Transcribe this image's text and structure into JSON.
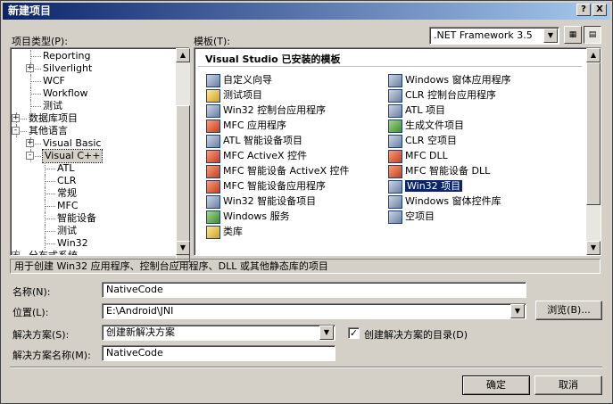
{
  "window": {
    "title": "新建项目",
    "help_btn": "?",
    "close_btn": "X"
  },
  "project_types": {
    "label": "项目类型(P):",
    "items": [
      {
        "text": "Reporting",
        "level": 2,
        "expander": ""
      },
      {
        "text": "Silverlight",
        "level": 2,
        "expander": "+"
      },
      {
        "text": "WCF",
        "level": 2,
        "expander": ""
      },
      {
        "text": "Workflow",
        "level": 2,
        "expander": ""
      },
      {
        "text": "测试",
        "level": 2,
        "expander": ""
      },
      {
        "text": "数据库项目",
        "level": 1,
        "expander": "+"
      },
      {
        "text": "其他语言",
        "level": 1,
        "expander": "-"
      },
      {
        "text": "Visual Basic",
        "level": 2,
        "expander": "+"
      },
      {
        "text": "Visual C++",
        "level": 2,
        "expander": "-"
      },
      {
        "text": "ATL",
        "level": 3,
        "expander": ""
      },
      {
        "text": "CLR",
        "level": 3,
        "expander": ""
      },
      {
        "text": "常规",
        "level": 3,
        "expander": ""
      },
      {
        "text": "MFC",
        "level": 3,
        "expander": ""
      },
      {
        "text": "智能设备",
        "level": 3,
        "expander": ""
      },
      {
        "text": "测试",
        "level": 3,
        "expander": ""
      },
      {
        "text": "Win32",
        "level": 3,
        "expander": ""
      },
      {
        "text": "分布式系统",
        "level": 1,
        "expander": "+"
      }
    ]
  },
  "templates": {
    "label": "模板(T):",
    "framework": ".NET Framework 3.5",
    "header": "Visual Studio 已安装的模板",
    "left": [
      {
        "text": "自定义向导",
        "icon": "wizard-icon",
        "c": "b"
      },
      {
        "text": "测试项目",
        "icon": "test-project-icon",
        "c": "y"
      },
      {
        "text": "Win32 控制台应用程序",
        "icon": "win32-console-icon",
        "c": "b"
      },
      {
        "text": "MFC 应用程序",
        "icon": "mfc-app-icon",
        "c": "r"
      },
      {
        "text": "ATL 智能设备项目",
        "icon": "atl-device-icon",
        "c": "b"
      },
      {
        "text": "MFC ActiveX 控件",
        "icon": "mfc-activex-icon",
        "c": "r"
      },
      {
        "text": "MFC 智能设备 ActiveX 控件",
        "icon": "mfc-device-activex-icon",
        "c": "r"
      },
      {
        "text": "MFC 智能设备应用程序",
        "icon": "mfc-device-app-icon",
        "c": "r"
      },
      {
        "text": "Win32 智能设备项目",
        "icon": "win32-device-icon",
        "c": "b"
      },
      {
        "text": "Windows 服务",
        "icon": "windows-service-icon",
        "c": "g"
      },
      {
        "text": "类库",
        "icon": "class-library-icon",
        "c": "y"
      }
    ],
    "right": [
      {
        "text": "Windows 窗体应用程序",
        "icon": "winforms-app-icon",
        "c": "b"
      },
      {
        "text": "CLR 控制台应用程序",
        "icon": "clr-console-icon",
        "c": "b"
      },
      {
        "text": "ATL 项目",
        "icon": "atl-project-icon",
        "c": "b"
      },
      {
        "text": "生成文件项目",
        "icon": "makefile-project-icon",
        "c": "g"
      },
      {
        "text": "CLR 空项目",
        "icon": "clr-empty-icon",
        "c": "b"
      },
      {
        "text": "MFC DLL",
        "icon": "mfc-dll-icon",
        "c": "r"
      },
      {
        "text": "MFC 智能设备 DLL",
        "icon": "mfc-device-dll-icon",
        "c": "r"
      },
      {
        "text": "Win32 项目",
        "icon": "win32-project-icon",
        "c": "b",
        "selected": true
      },
      {
        "text": "Windows 窗体控件库",
        "icon": "winforms-control-icon",
        "c": "b"
      },
      {
        "text": "空项目",
        "icon": "empty-project-icon",
        "c": "b"
      }
    ]
  },
  "description": "用于创建 Win32 应用程序、控制台应用程序、DLL 或其他静态库的项目",
  "form": {
    "name_label": "名称(N):",
    "name_value": "NativeCode",
    "location_label": "位置(L):",
    "location_value": "E:\\Android\\JNI",
    "browse_btn": "浏览(B)...",
    "solution_label": "解决方案(S):",
    "solution_value": "创建新解决方案",
    "create_dir_label": "创建解决方案的目录(D)",
    "solution_name_label": "解决方案名称(M):",
    "solution_name_value": "NativeCode"
  },
  "buttons": {
    "ok": "确定",
    "cancel": "取消"
  }
}
